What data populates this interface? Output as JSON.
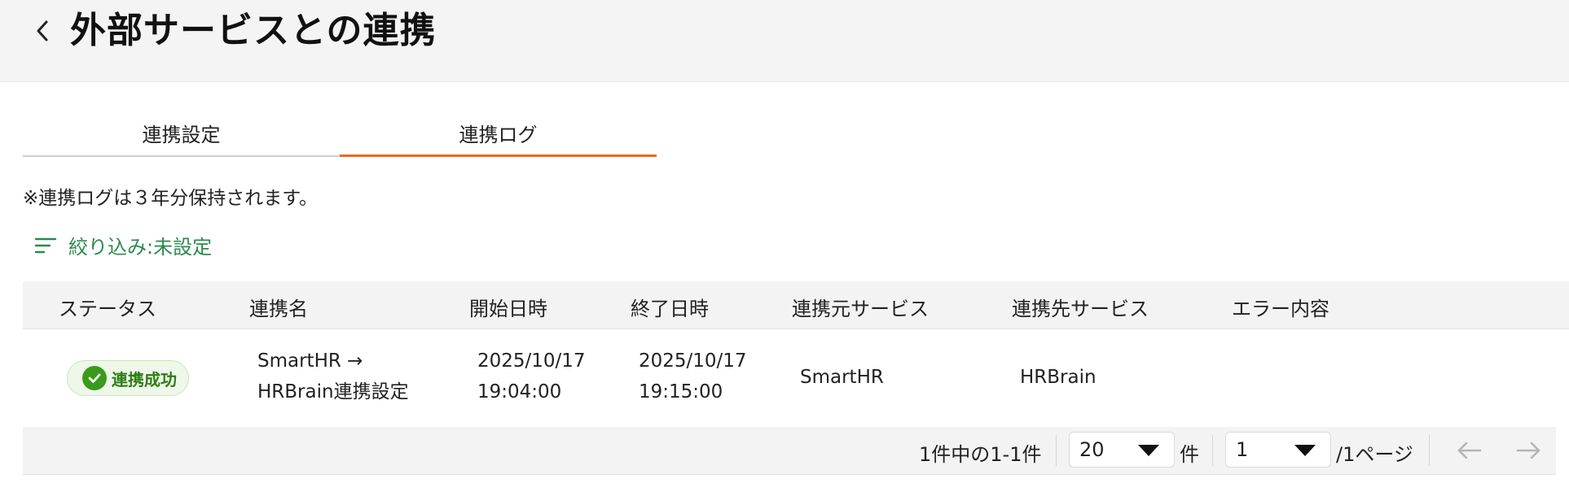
{
  "header": {
    "title": "外部サービスとの連携",
    "back_icon": "chevron-left-icon"
  },
  "tabs": [
    {
      "label": "連携設定",
      "active": false
    },
    {
      "label": "連携ログ",
      "active": true
    }
  ],
  "note": "※連携ログは３年分保持されます。",
  "filter": {
    "icon": "filter-lines-icon",
    "label": "絞り込み:未設定"
  },
  "table": {
    "columns": [
      "ステータス",
      "連携名",
      "開始日時",
      "終了日時",
      "連携元サービス",
      "連携先サービス",
      "エラー内容"
    ],
    "rows": [
      {
        "status": "連携成功",
        "name_line1": "SmartHR →",
        "name_line2": "HRBrain連携設定",
        "start_date": "2025/10/17",
        "start_time": "19:04:00",
        "end_date": "2025/10/17",
        "end_time": "19:15:00",
        "source": "SmartHR",
        "target": "HRBrain",
        "error": ""
      }
    ]
  },
  "pagination": {
    "summary": "1件中の1-1件",
    "page_size": "20",
    "page_size_unit": "件",
    "current_page": "1",
    "page_total": "/1ページ",
    "prev_icon": "arrow-left-icon",
    "next_icon": "arrow-right-icon"
  },
  "colors": {
    "accent": "#ec6b1e",
    "filter": "#2b8a4e",
    "success": "#3a9a1b"
  }
}
